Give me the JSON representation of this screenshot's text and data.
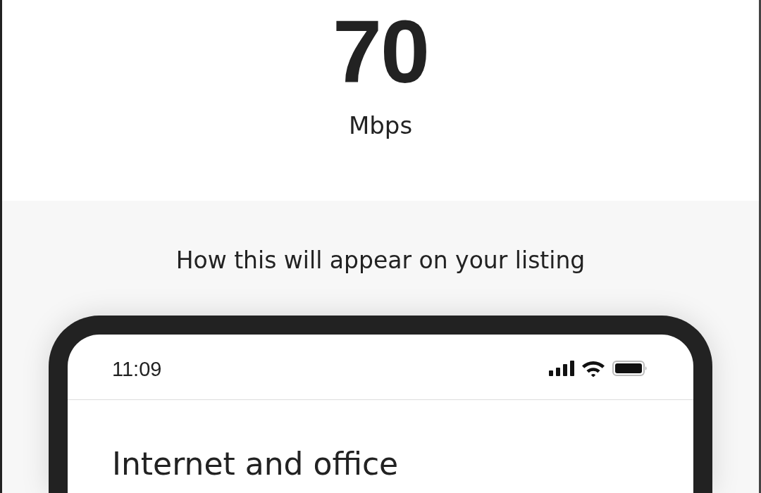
{
  "speed": {
    "value": "70",
    "unit": "Mbps"
  },
  "preview": {
    "caption": "How this will appear on your listing",
    "phone": {
      "status_bar": {
        "time": "11:09"
      },
      "heading": "Internet and office"
    }
  }
}
